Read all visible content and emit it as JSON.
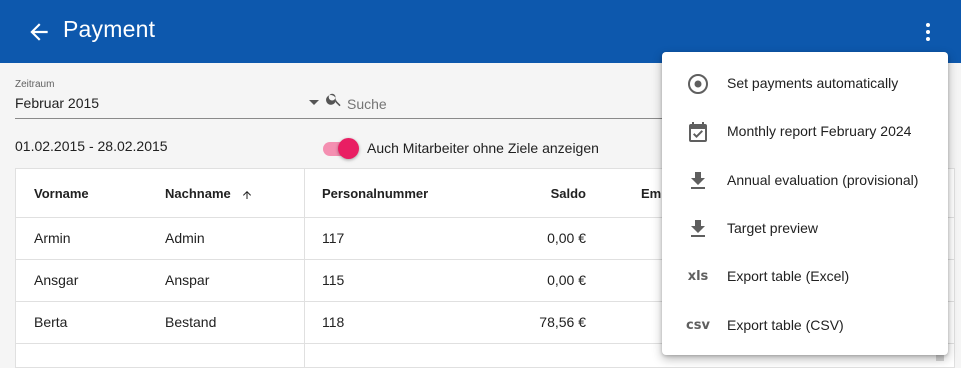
{
  "header": {
    "back_icon": "arrow-left-icon",
    "title": "Payment",
    "more_icon": "more-vertical-icon",
    "bg_color": "#0d58ad"
  },
  "filters": {
    "period_label": "Zeitraum",
    "period_value": "Februar 2015",
    "search_placeholder": "Suche",
    "date_range": "01.02.2015 - 28.02.2015",
    "toggle_label": "Auch Mitarbeiter ohne Ziele anzeigen",
    "toggle_on": true,
    "toggle_color": "#e91e63"
  },
  "table": {
    "headers": {
      "vorname": "Vorname",
      "nachname": "Nachname",
      "personalnummer": "Personalnummer",
      "saldo": "Saldo",
      "emp": "Em"
    },
    "sort": "Nachname ascending",
    "rows": [
      {
        "vorname": "Armin",
        "nachname": "Admin",
        "personalnummer": "117",
        "saldo": "0,00 €"
      },
      {
        "vorname": "Ansgar",
        "nachname": "Anspar",
        "personalnummer": "115",
        "saldo": "0,00 €"
      },
      {
        "vorname": "Berta",
        "nachname": "Bestand",
        "personalnummer": "118",
        "saldo": "78,56 €"
      }
    ]
  },
  "menu": {
    "items": [
      {
        "icon": "radio-target-icon",
        "label": "Set payments automatically"
      },
      {
        "icon": "calendar-check-icon",
        "label": "Monthly report February 2024"
      },
      {
        "icon": "download-icon",
        "label": "Annual evaluation (provisional)"
      },
      {
        "icon": "download-icon",
        "label": "Target preview"
      },
      {
        "icon": "xls",
        "label": "Export table (Excel)"
      },
      {
        "icon": "csv",
        "label": "Export table (CSV)"
      }
    ]
  }
}
